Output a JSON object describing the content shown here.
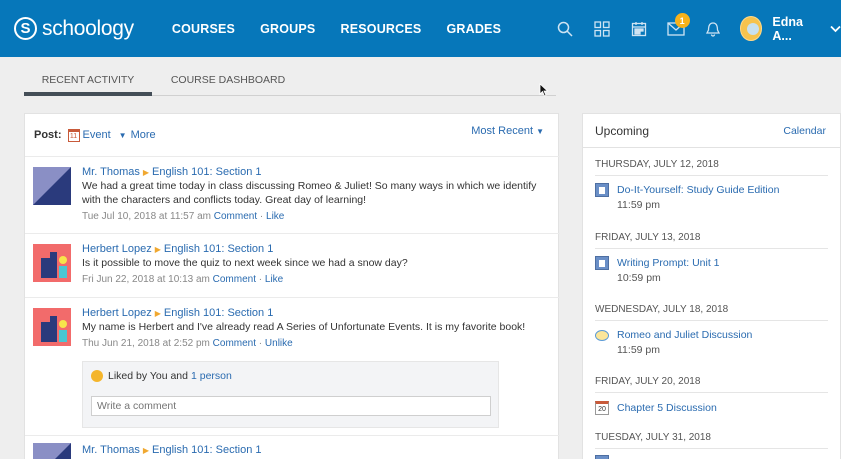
{
  "brand": {
    "name": "schoology"
  },
  "nav": {
    "links": [
      "COURSES",
      "GROUPS",
      "RESOURCES",
      "GRADES"
    ],
    "message_badge": "1",
    "user_name": "Edna A..."
  },
  "tabs": {
    "recent": "RECENT ACTIVITY",
    "dashboard": "COURSE DASHBOARD"
  },
  "post_bar": {
    "label": "Post:",
    "event": "Event",
    "event_icon_text": "11",
    "more": "More",
    "sort": "Most Recent"
  },
  "feed": [
    {
      "author": "Mr. Thomas",
      "course": "English 101: Section 1",
      "text": "We had a great time today in class discussing Romeo & Juliet! So many ways in which we identify with the characters and conflicts today. Great day of learning!",
      "time": "Tue Jul 10, 2018 at 11:57 am",
      "comment": "Comment",
      "like": "Like"
    },
    {
      "author": "Herbert Lopez",
      "course": "English 101: Section 1",
      "text": "Is it possible to move the quiz to next week since we had a snow day?",
      "time": "Fri Jun 22, 2018 at 10:13 am",
      "comment": "Comment",
      "like": "Like"
    },
    {
      "author": "Herbert Lopez",
      "course": "English 101: Section 1",
      "text": "My name is Herbert and I've already read A Series of Unfortunate Events. It is my favorite book!",
      "time": "Thu Jun 21, 2018 at 2:52 pm",
      "comment": "Comment",
      "like": "Unlike"
    },
    {
      "author": "Mr. Thomas",
      "course": "English 101: Section 1"
    }
  ],
  "likes": {
    "text": "Liked by You and",
    "link": "1 person",
    "placeholder": "Write a comment"
  },
  "upcoming": {
    "title": "Upcoming",
    "calendar": "Calendar",
    "groups": [
      {
        "date": "THURSDAY, JULY 12, 2018",
        "name": "Do-It-Yourself: Study Guide Edition",
        "time": "11:59 pm",
        "icon": "assignment-icon"
      },
      {
        "date": "FRIDAY, JULY 13, 2018",
        "name": "Writing Prompt: Unit 1",
        "time": "10:59 pm",
        "icon": "assignment-icon"
      },
      {
        "date": "WEDNESDAY, JULY 18, 2018",
        "name": "Romeo and Juliet Discussion",
        "time": "11:59 pm",
        "icon": "discussion-icon"
      },
      {
        "date": "FRIDAY, JULY 20, 2018",
        "name": "Chapter 5 Discussion",
        "time": "",
        "icon": "calendar-event-icon",
        "icon_text": "20"
      },
      {
        "date": "TUESDAY, JULY 31, 2018"
      }
    ]
  }
}
